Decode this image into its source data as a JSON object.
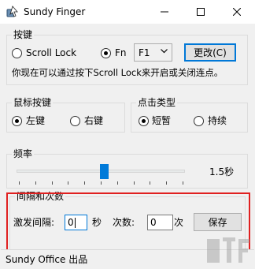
{
  "window": {
    "title": "Sundy Finger"
  },
  "hotkey_group": {
    "legend": "按键",
    "option_scroll_lock": "Scroll Lock",
    "option_fn": "Fn",
    "selected": "Fn",
    "fn_select_value": "F1",
    "change_button": "更改(C)",
    "hint": "你现在可以通过按下Scroll Lock来开启或关闭连点。"
  },
  "mouse_group": {
    "legend": "鼠标按键",
    "option_left": "左键",
    "option_right": "右键",
    "selected": "左键"
  },
  "click_type_group": {
    "legend": "点击类型",
    "option_short": "短暂",
    "option_continuous": "持续",
    "selected": "短暂"
  },
  "frequency_group": {
    "legend": "频率",
    "value_label": "1.5秒",
    "slider_value": 0.52
  },
  "interval_group": {
    "legend": "间隔和次数",
    "interval_label": "激发间隔:",
    "interval_value": "0",
    "interval_unit": "秒",
    "count_label": "次数:",
    "count_value": "0",
    "count_unit": "次",
    "save_button": "保存"
  },
  "statusbar": {
    "text": "Sundy Office 出品"
  },
  "colors": {
    "accent": "#0078d7",
    "highlight_box": "#e02020",
    "slider_thumb": "#007ad9"
  }
}
